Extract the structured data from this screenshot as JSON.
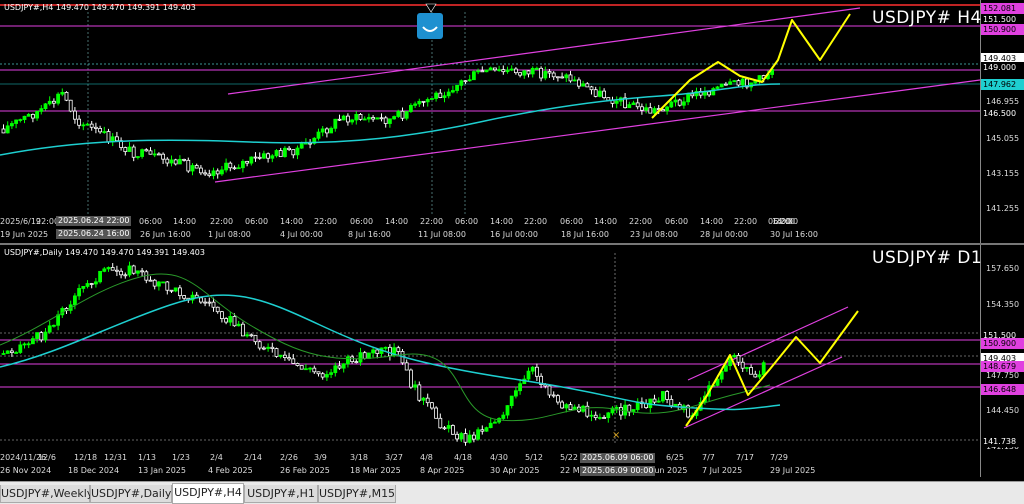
{
  "h4": {
    "info": "USDJPY#,H4  149.470 149.470 149.391 149.403",
    "title": "USDJPY# H4",
    "price_ticks": [
      "151.500",
      "149.403",
      "149.000",
      "146.955",
      "146.500",
      "145.055",
      "143.155",
      "141.255"
    ],
    "price_boxes": [
      {
        "label": "152.081",
        "bg": "#e040e0",
        "fg": "#000"
      },
      {
        "label": "151.500",
        "bg": "#000",
        "fg": "#fff"
      },
      {
        "label": "150.900",
        "bg": "#e040e0",
        "fg": "#000"
      },
      {
        "label": "149.403",
        "bg": "#fff",
        "fg": "#000"
      },
      {
        "label": "149.000",
        "bg": "#000",
        "fg": "#fff"
      },
      {
        "label": "147.962",
        "bg": "#1ecfd0",
        "fg": "#000"
      },
      {
        "label": "146.500",
        "bg": "#000",
        "fg": "#fff"
      }
    ],
    "time_top": [
      "2025/6/19",
      "22:00",
      "06:00",
      "14:00",
      "22:00",
      "06:00",
      "14:00",
      "22:00",
      "06:00",
      "14:00",
      "22:00",
      "06:00",
      "14:00",
      "22:00",
      "06:00",
      "14:00",
      "22:00",
      "06:00",
      "14:00",
      "22:00",
      "06:00",
      "14:00",
      "22:00"
    ],
    "time_bottom": [
      "19 Jun 2025",
      "26 Jun 16:00",
      "1 Jul 08:00",
      "4 Jul 00:00",
      "8 Jul 16:00",
      "11 Jul 08:00",
      "16 Jul 00:00",
      "18 Jul 16:00",
      "23 Jul 08:00",
      "28 Jul 00:00",
      "30 Jul 16:00"
    ],
    "crosshair_top": "2025.06.24 22:00",
    "crosshair_bottom": "2025.06.24 16:00"
  },
  "d1": {
    "info": "USDJPY#,Daily  149.470 149.470 149.391 149.403",
    "title": "USDJPY# D1",
    "price_ticks": [
      "157.650",
      "154.350",
      "151.500",
      "147.750",
      "144.450",
      "141.150"
    ],
    "price_boxes": [
      {
        "label": "151.500",
        "bg": "#000",
        "fg": "#fff"
      },
      {
        "label": "150.900",
        "bg": "#e040e0",
        "fg": "#000"
      },
      {
        "label": "149.403",
        "bg": "#fff",
        "fg": "#000"
      },
      {
        "label": "148.679",
        "bg": "#e040e0",
        "fg": "#000"
      },
      {
        "label": "146.648",
        "bg": "#e040e0",
        "fg": "#000"
      },
      {
        "label": "141.738",
        "bg": "#000",
        "fg": "#fff"
      }
    ],
    "time_top": [
      "2024/11/26",
      "12/6",
      "12/18",
      "12/31",
      "1/13",
      "1/23",
      "2/4",
      "2/14",
      "2/26",
      "3/9",
      "3/18",
      "3/27",
      "4/8",
      "4/18",
      "4/30",
      "5/12",
      "5/22",
      "6/25",
      "7/7",
      "7/17",
      "7/29"
    ],
    "time_bottom": [
      "26 Nov 2024",
      "18 Dec 2024",
      "13 Jan 2025",
      "4 Feb 2025",
      "26 Feb 2025",
      "18 Mar 2025",
      "8 Apr 2025",
      "30 Apr 2025",
      "22 Ma",
      "Jun 2025",
      "7 Jul 2025",
      "29 Jul 2025"
    ],
    "crosshair_top": "2025.06.09 06:00",
    "crosshair_bottom": "2025.06.09 00:00"
  },
  "tabs": [
    "USDJPY#,Weekly",
    "USDJPY#,Daily",
    "USDJPY#,H4",
    "USDJPY#,H1",
    "USDJPY#,M15"
  ],
  "active_tab": "USDJPY#,H4",
  "colors": {
    "bull": "#00ff00",
    "bear": "#ffffff",
    "channel": "#e040e0",
    "ma": "#1ecfd0",
    "projection": "#ffff00",
    "hline": "#e040e0",
    "dotted": "#4fc3c3"
  }
}
